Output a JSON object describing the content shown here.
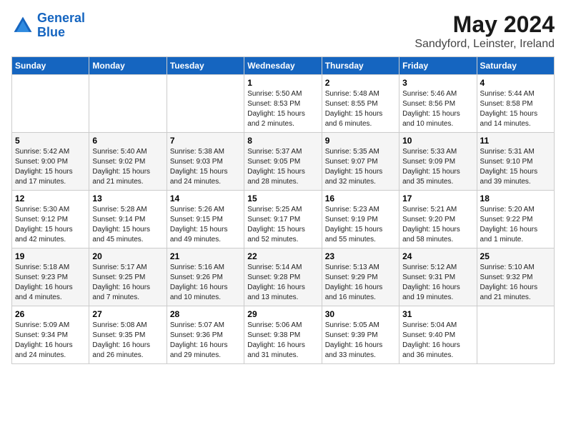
{
  "header": {
    "logo_line1": "General",
    "logo_line2": "Blue",
    "title": "May 2024",
    "subtitle": "Sandyford, Leinster, Ireland"
  },
  "days_of_week": [
    "Sunday",
    "Monday",
    "Tuesday",
    "Wednesday",
    "Thursday",
    "Friday",
    "Saturday"
  ],
  "weeks": [
    [
      {
        "day": "",
        "info": ""
      },
      {
        "day": "",
        "info": ""
      },
      {
        "day": "",
        "info": ""
      },
      {
        "day": "1",
        "info": "Sunrise: 5:50 AM\nSunset: 8:53 PM\nDaylight: 15 hours\nand 2 minutes."
      },
      {
        "day": "2",
        "info": "Sunrise: 5:48 AM\nSunset: 8:55 PM\nDaylight: 15 hours\nand 6 minutes."
      },
      {
        "day": "3",
        "info": "Sunrise: 5:46 AM\nSunset: 8:56 PM\nDaylight: 15 hours\nand 10 minutes."
      },
      {
        "day": "4",
        "info": "Sunrise: 5:44 AM\nSunset: 8:58 PM\nDaylight: 15 hours\nand 14 minutes."
      }
    ],
    [
      {
        "day": "5",
        "info": "Sunrise: 5:42 AM\nSunset: 9:00 PM\nDaylight: 15 hours\nand 17 minutes."
      },
      {
        "day": "6",
        "info": "Sunrise: 5:40 AM\nSunset: 9:02 PM\nDaylight: 15 hours\nand 21 minutes."
      },
      {
        "day": "7",
        "info": "Sunrise: 5:38 AM\nSunset: 9:03 PM\nDaylight: 15 hours\nand 24 minutes."
      },
      {
        "day": "8",
        "info": "Sunrise: 5:37 AM\nSunset: 9:05 PM\nDaylight: 15 hours\nand 28 minutes."
      },
      {
        "day": "9",
        "info": "Sunrise: 5:35 AM\nSunset: 9:07 PM\nDaylight: 15 hours\nand 32 minutes."
      },
      {
        "day": "10",
        "info": "Sunrise: 5:33 AM\nSunset: 9:09 PM\nDaylight: 15 hours\nand 35 minutes."
      },
      {
        "day": "11",
        "info": "Sunrise: 5:31 AM\nSunset: 9:10 PM\nDaylight: 15 hours\nand 39 minutes."
      }
    ],
    [
      {
        "day": "12",
        "info": "Sunrise: 5:30 AM\nSunset: 9:12 PM\nDaylight: 15 hours\nand 42 minutes."
      },
      {
        "day": "13",
        "info": "Sunrise: 5:28 AM\nSunset: 9:14 PM\nDaylight: 15 hours\nand 45 minutes."
      },
      {
        "day": "14",
        "info": "Sunrise: 5:26 AM\nSunset: 9:15 PM\nDaylight: 15 hours\nand 49 minutes."
      },
      {
        "day": "15",
        "info": "Sunrise: 5:25 AM\nSunset: 9:17 PM\nDaylight: 15 hours\nand 52 minutes."
      },
      {
        "day": "16",
        "info": "Sunrise: 5:23 AM\nSunset: 9:19 PM\nDaylight: 15 hours\nand 55 minutes."
      },
      {
        "day": "17",
        "info": "Sunrise: 5:21 AM\nSunset: 9:20 PM\nDaylight: 15 hours\nand 58 minutes."
      },
      {
        "day": "18",
        "info": "Sunrise: 5:20 AM\nSunset: 9:22 PM\nDaylight: 16 hours\nand 1 minute."
      }
    ],
    [
      {
        "day": "19",
        "info": "Sunrise: 5:18 AM\nSunset: 9:23 PM\nDaylight: 16 hours\nand 4 minutes."
      },
      {
        "day": "20",
        "info": "Sunrise: 5:17 AM\nSunset: 9:25 PM\nDaylight: 16 hours\nand 7 minutes."
      },
      {
        "day": "21",
        "info": "Sunrise: 5:16 AM\nSunset: 9:26 PM\nDaylight: 16 hours\nand 10 minutes."
      },
      {
        "day": "22",
        "info": "Sunrise: 5:14 AM\nSunset: 9:28 PM\nDaylight: 16 hours\nand 13 minutes."
      },
      {
        "day": "23",
        "info": "Sunrise: 5:13 AM\nSunset: 9:29 PM\nDaylight: 16 hours\nand 16 minutes."
      },
      {
        "day": "24",
        "info": "Sunrise: 5:12 AM\nSunset: 9:31 PM\nDaylight: 16 hours\nand 19 minutes."
      },
      {
        "day": "25",
        "info": "Sunrise: 5:10 AM\nSunset: 9:32 PM\nDaylight: 16 hours\nand 21 minutes."
      }
    ],
    [
      {
        "day": "26",
        "info": "Sunrise: 5:09 AM\nSunset: 9:34 PM\nDaylight: 16 hours\nand 24 minutes."
      },
      {
        "day": "27",
        "info": "Sunrise: 5:08 AM\nSunset: 9:35 PM\nDaylight: 16 hours\nand 26 minutes."
      },
      {
        "day": "28",
        "info": "Sunrise: 5:07 AM\nSunset: 9:36 PM\nDaylight: 16 hours\nand 29 minutes."
      },
      {
        "day": "29",
        "info": "Sunrise: 5:06 AM\nSunset: 9:38 PM\nDaylight: 16 hours\nand 31 minutes."
      },
      {
        "day": "30",
        "info": "Sunrise: 5:05 AM\nSunset: 9:39 PM\nDaylight: 16 hours\nand 33 minutes."
      },
      {
        "day": "31",
        "info": "Sunrise: 5:04 AM\nSunset: 9:40 PM\nDaylight: 16 hours\nand 36 minutes."
      },
      {
        "day": "",
        "info": ""
      }
    ]
  ]
}
